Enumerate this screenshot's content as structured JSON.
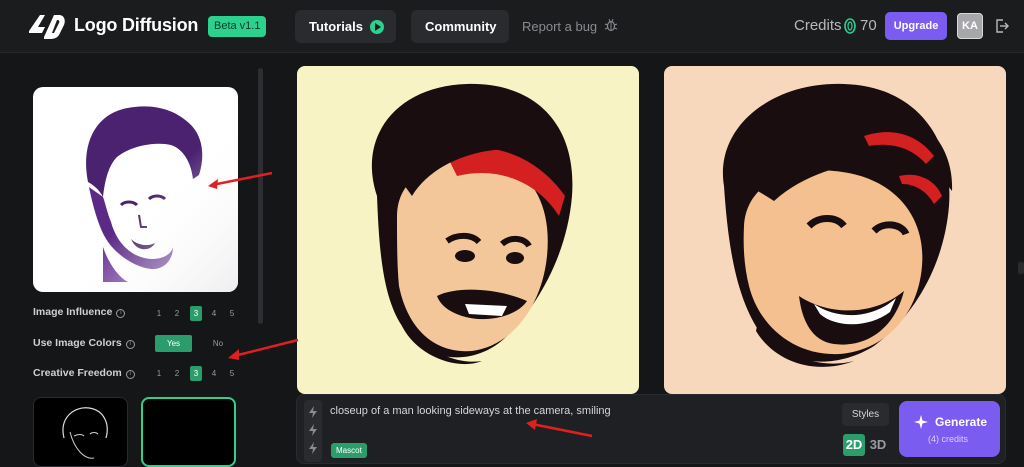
{
  "header": {
    "logo_text": "Logo Diffusion",
    "beta_badge": "Beta v1.1",
    "tutorials_label": "Tutorials",
    "community_label": "Community",
    "report_label": "Report a bug",
    "credits_label": "Credits",
    "credits_value": "70",
    "upgrade_label": "Upgrade",
    "avatar_initials": "KA"
  },
  "sidebar": {
    "image_influence": {
      "label": "Image Influence",
      "steps": [
        "1",
        "2",
        "3",
        "4",
        "5"
      ],
      "selected": 3
    },
    "use_image_colors": {
      "label": "Use Image Colors",
      "yes": "Yes",
      "no": "No",
      "selected": "Yes"
    },
    "creative_freedom": {
      "label": "Creative Freedom",
      "steps": [
        "1",
        "2",
        "3",
        "4",
        "5"
      ],
      "selected": 3
    }
  },
  "prompt": {
    "text": "closeup of a man looking sideways at the camera, smiling",
    "tag": "Mascot",
    "styles_label": "Styles",
    "mode_2d": "2D",
    "mode_3d": "3D",
    "generate_label": "Generate",
    "generate_sub": "(4) credits"
  },
  "colors": {
    "accent_green": "#2bd18d",
    "accent_purple": "#7b5cf0",
    "annotation_red": "#e02020"
  }
}
